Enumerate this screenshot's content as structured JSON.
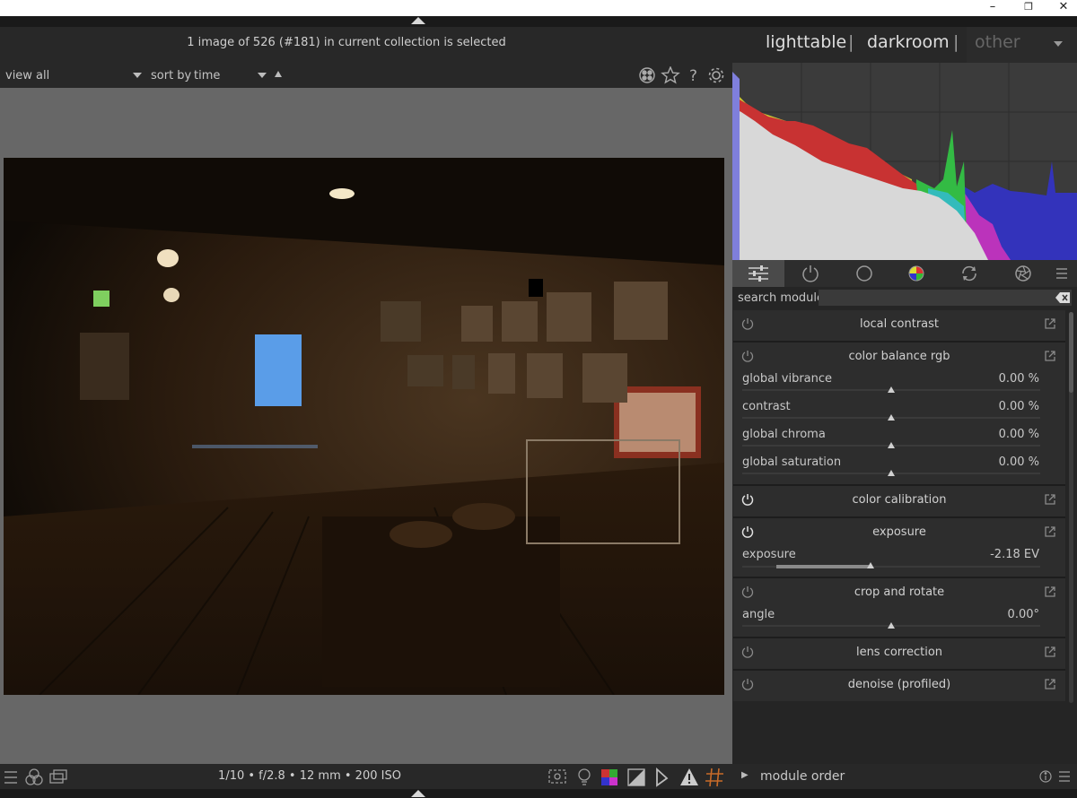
{
  "window_controls": {
    "minimize": "–",
    "restore": "❐",
    "close": "✕"
  },
  "header": {
    "collection_info": "1 image of 526 (#181) in current collection is selected",
    "views": {
      "lighttable": "lighttable",
      "darkroom": "darkroom",
      "other": "other"
    },
    "separator": "|"
  },
  "filterbar": {
    "view_label": "view",
    "view_value": "all",
    "sort_label": "sort by",
    "sort_value": "time"
  },
  "histogram": {
    "channels": [
      "red",
      "green",
      "blue"
    ],
    "colors": {
      "red": "#c83232",
      "yellow": "#cccc33",
      "green": "#33bb44",
      "cyan": "#33bbbb",
      "magenta": "#bb33bb",
      "blue": "#3333bb",
      "white": "#d8d8d8"
    }
  },
  "module_tabs": [
    {
      "name": "active-modules-tab",
      "icon": "sliders-icon"
    },
    {
      "name": "base-modules-tab",
      "icon": "power-icon"
    },
    {
      "name": "tone-modules-tab",
      "icon": "circle-icon"
    },
    {
      "name": "color-modules-tab",
      "icon": "color-wheel-icon"
    },
    {
      "name": "correct-modules-tab",
      "icon": "rotate-icon"
    },
    {
      "name": "effect-modules-tab",
      "icon": "aperture-icon"
    },
    {
      "name": "presets-menu",
      "icon": "hamburger-icon"
    }
  ],
  "search": {
    "label": "search module",
    "placeholder": ""
  },
  "modules": {
    "local_contrast": {
      "title": "local contrast"
    },
    "color_balance": {
      "title": "color balance rgb",
      "sliders": [
        {
          "label": "global vibrance",
          "value": "0.00 %",
          "level": 0.5
        },
        {
          "label": "contrast",
          "value": "0.00 %",
          "level": 0.5
        },
        {
          "label": "global chroma",
          "value": "0.00 %",
          "level": 0.5
        },
        {
          "label": "global saturation",
          "value": "0.00 %",
          "level": 0.5
        }
      ]
    },
    "color_calibration": {
      "title": "color calibration"
    },
    "exposure": {
      "title": "exposure",
      "slider": {
        "label": "exposure",
        "value": "-2.18 EV",
        "level": 0.43
      }
    },
    "crop_rotate": {
      "title": "crop and rotate",
      "slider": {
        "label": "angle",
        "value": "0.00°",
        "level": 0.5
      }
    },
    "lens_correction": {
      "title": "lens correction"
    },
    "denoise": {
      "title": "denoise (profiled)"
    }
  },
  "bottombar": {
    "exif": "1/10 • f/2.8 • 12 mm • 200 ISO",
    "module_order_arrow": "▶",
    "module_order": "module order"
  }
}
